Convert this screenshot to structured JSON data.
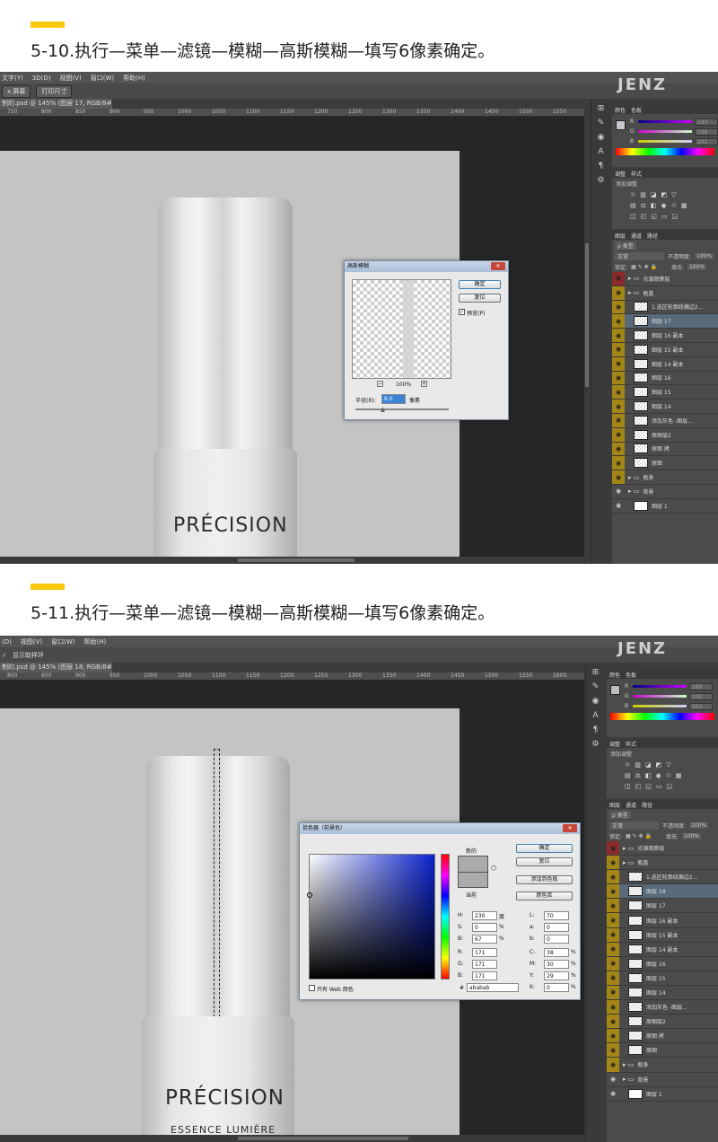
{
  "step1": {
    "title": "5-10.执行—菜单—滤镜—模糊—高斯模糊—填写6像素确定。",
    "menu": [
      "文字(Y)",
      "3D(D)",
      "视图(V)",
      "窗口(W)",
      "帮助(H)"
    ],
    "options": [
      "x 屏幕",
      "打印尺寸"
    ],
    "doc_tab": "制的.psd @ 145% (图层 17, RGB/8#) *",
    "ruler": [
      "750",
      "800",
      "850",
      "900",
      "950",
      "1000",
      "1050",
      "1100",
      "1150",
      "1200",
      "1250",
      "1300",
      "1350",
      "1400",
      "1450",
      "1500",
      "1550"
    ],
    "brand": "PRÉCISION",
    "logo": "JENZ",
    "color_panel": {
      "tabs": [
        "颜色",
        "色板"
      ],
      "rows": [
        {
          "lbl": "R",
          "val": "197"
        },
        {
          "lbl": "G",
          "val": "198"
        },
        {
          "lbl": "B",
          "val": "201"
        }
      ]
    },
    "adjust": {
      "tabs": [
        "调整",
        "样式"
      ],
      "label": "添加调整"
    },
    "layers": {
      "tabs": [
        "图层",
        "通道",
        "路径"
      ],
      "kind": "ρ 类型",
      "blend": "正常",
      "opacity_label": "不透明度:",
      "opacity": "100%",
      "lock_label": "锁定:",
      "fill_label": "填充:",
      "fill": "100%",
      "items": [
        "光源观察层",
        "瓶盖",
        "1.选区轮廓线偏边2...",
        "图层 17",
        "图层 16 副本",
        "图层 15 副本",
        "图层 14 副本",
        "图层 16",
        "图层 15",
        "图层 14",
        "添加灰色 -图层...",
        "原图层2",
        "原图 拷",
        "原图",
        "瓶身",
        "背景",
        "图层 1"
      ]
    },
    "gauss": {
      "title": "高斯模糊",
      "ok": "确定",
      "reset": "复位",
      "preview": "预览(P)",
      "zoom": "100%",
      "radius_label": "半径(R):",
      "radius": "6.0",
      "unit": "像素"
    }
  },
  "step2": {
    "title": "5-11.执行—菜单—滤镜—模糊—高斯模糊—填写6像素确定。",
    "menu": [
      "(D)",
      "视图(V)",
      "窗口(W)",
      "帮助(H)"
    ],
    "options": [
      "显示取样环"
    ],
    "doc_tab": "制的.psd @ 145% (图层 18, RGB/8#) *",
    "ruler": [
      "800",
      "850",
      "900",
      "950",
      "1000",
      "1050",
      "1100",
      "1150",
      "1200",
      "1250",
      "1300",
      "1350",
      "1400",
      "1450",
      "1500",
      "1550",
      "1600"
    ],
    "brand": "PRÉCISION",
    "sub_brand": "ESSENCE LUMIÈRE",
    "logo": "JENZ",
    "color_panel": {
      "tabs": [
        "颜色",
        "色板"
      ],
      "rows": [
        {
          "lbl": "R",
          "val": "189"
        },
        {
          "lbl": "G",
          "val": "190"
        },
        {
          "lbl": "B",
          "val": "193"
        }
      ]
    },
    "adjust": {
      "tabs": [
        "调整",
        "样式"
      ],
      "label": "添加调整"
    },
    "layers": {
      "tabs": [
        "图层",
        "通道",
        "路径"
      ],
      "kind": "ρ 类型",
      "blend": "正常",
      "opacity_label": "不透明度:",
      "opacity": "100%",
      "lock_label": "锁定:",
      "fill_label": "填充:",
      "fill": "100%",
      "items": [
        "光源观察层",
        "瓶盖",
        "1.选区轮廓线偏边2...",
        "图层 18",
        "图层 17",
        "图层 16 副本",
        "图层 15 副本",
        "图层 14 副本",
        "图层 16",
        "图层 15",
        "图层 14",
        "添加灰色 -图层...",
        "原图层2",
        "原图 拷",
        "原图",
        "瓶身",
        "背景",
        "图层 1"
      ]
    },
    "picker": {
      "title": "拾色器（前景色）",
      "ok": "确定",
      "reset": "复位",
      "add_swatch": "添加到色板",
      "library": "颜色库",
      "new_label": "新的",
      "current_label": "当前",
      "web_only": "只有 Web 颜色",
      "hex_label": "#",
      "hex": "ababab",
      "hsb": [
        {
          "lbl": "H:",
          "val": "230",
          "unit": "度"
        },
        {
          "lbl": "S:",
          "val": "0",
          "unit": "%"
        },
        {
          "lbl": "B:",
          "val": "67",
          "unit": "%"
        }
      ],
      "rgb": [
        {
          "lbl": "R:",
          "val": "171"
        },
        {
          "lbl": "G:",
          "val": "171"
        },
        {
          "lbl": "B:",
          "val": "171"
        }
      ],
      "lab": [
        {
          "lbl": "L:",
          "val": "70"
        },
        {
          "lbl": "a:",
          "val": "0"
        },
        {
          "lbl": "b:",
          "val": "0"
        }
      ],
      "cmyk": [
        {
          "lbl": "C:",
          "val": "38"
        },
        {
          "lbl": "M:",
          "val": "30"
        },
        {
          "lbl": "Y:",
          "val": "29"
        },
        {
          "lbl": "K:",
          "val": "0"
        }
      ],
      "new_color": "#ababab",
      "current_color": "#ababab"
    }
  },
  "colors": {
    "accent": "#f7c80b",
    "layer_eye": "#a38616",
    "selected": "#596a7a"
  }
}
